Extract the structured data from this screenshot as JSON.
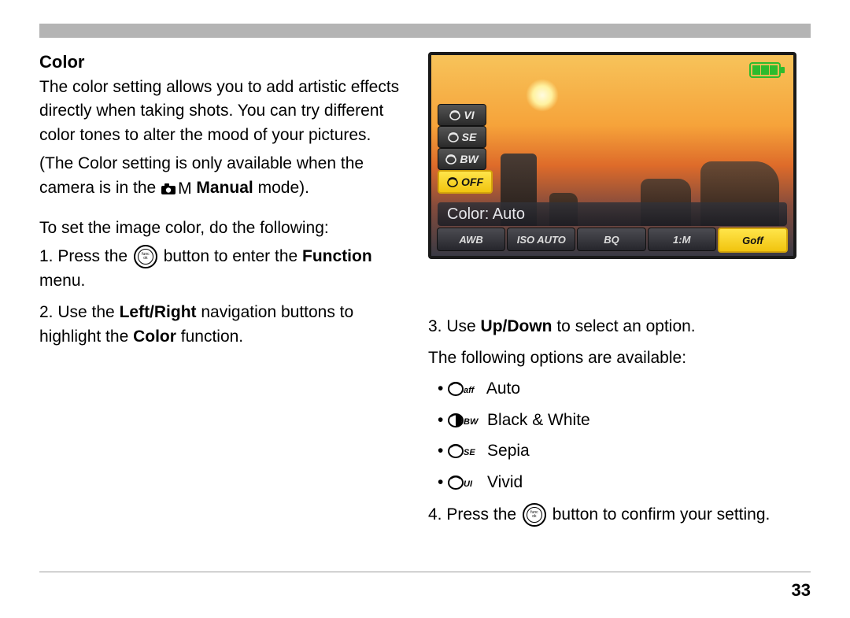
{
  "section": {
    "title": "Color",
    "intro1": "The color setting allows you to add artistic effects directly when taking shots. You can try different color tones to alter the mood of your pictures.",
    "intro2_a": "(The Color setting is only available when the camera is in the ",
    "manual_bold": "Manual",
    "intro2_b": " mode).",
    "lead": "To set the image color, do the following:",
    "step1_a": "1. Press the ",
    "step1_b": " button to enter the ",
    "step1_bold": "Function",
    "step1_c": " menu.",
    "step2_a": "2. Use the ",
    "step2_bold1": "Left/Right",
    "step2_b": " navigation buttons to highlight the ",
    "step2_bold2": "Color",
    "step2_c": " function.",
    "step3_a": "3. Use ",
    "step3_bold": "Up/Down",
    "step3_b": " to select an option.",
    "step3_follow": "The following options are available:",
    "options": {
      "auto": "Auto",
      "bw": "Black & White",
      "sepia": "Sepia",
      "vivid": "Vivid"
    },
    "step4_a": "4. Press the ",
    "step4_b": " button to confirm your setting."
  },
  "lcd": {
    "side_items": [
      "VI",
      "SE",
      "BW",
      "OFF"
    ],
    "selected_index": 3,
    "color_label": "Color: Auto",
    "bottom_items": [
      "AWB",
      "ISO AUTO",
      "BQ",
      "1:M",
      "Goff"
    ],
    "bottom_selected_index": 4
  },
  "ui": {
    "battery_level": 3,
    "func_ok_top": "func",
    "func_ok_bottom": "ok",
    "mode_letter": "M"
  },
  "page_number": "33"
}
